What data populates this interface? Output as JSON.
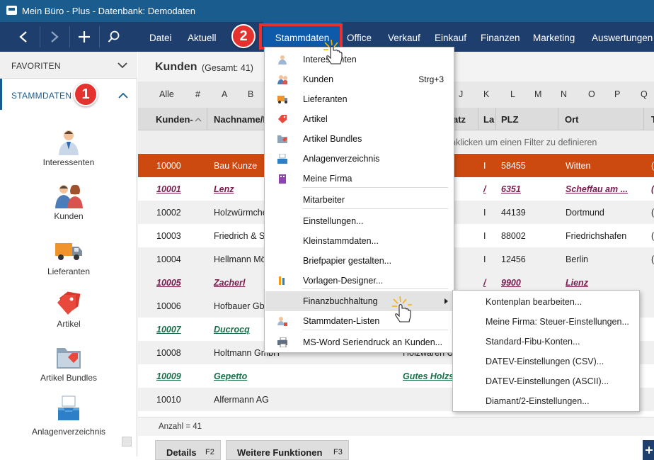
{
  "window": {
    "title": "Mein Büro - Plus - Datenbank: Demodaten"
  },
  "nav": {
    "back": "back",
    "forward": "forward",
    "add": "add",
    "search": "search"
  },
  "menu": [
    "Datei",
    "Aktuell",
    "Stammdaten",
    "Office",
    "Verkauf",
    "Einkauf",
    "Finanzen",
    "Marketing",
    "Auswertungen"
  ],
  "badges": {
    "one": "1",
    "two": "2"
  },
  "sidebar": {
    "favorites": "FAVORITEN",
    "section": "STAMMDATEN",
    "items": [
      "Interessenten",
      "Kunden",
      "Lieferanten",
      "Artikel",
      "Artikel Bundles",
      "Anlagenverzeichnis"
    ]
  },
  "list": {
    "title": "Kunden",
    "subtitle": "(Gesamt: 41)",
    "alphabet": [
      "Alle",
      "#",
      "A",
      "B",
      "J",
      "K",
      "L",
      "M",
      "N",
      "O",
      "P",
      "Q"
    ],
    "columns": [
      "Kunden-",
      "Nachname/F",
      "atz",
      "La",
      "PLZ",
      "Ort",
      "T"
    ],
    "filter_hint": "nklicken um einen Filter zu definieren",
    "rows": [
      {
        "nr": "10000",
        "name": "Bau Kunze",
        "extra": "",
        "la": "I",
        "plz": "58455",
        "ort": "Witten",
        "t": "("
      },
      {
        "nr": "10001",
        "name": "Lenz",
        "extra": "",
        "la": "/",
        "plz": "6351",
        "ort": "Scheffau am ...",
        "t": "("
      },
      {
        "nr": "10002",
        "name": "Holzwürmche",
        "extra": "",
        "la": "I",
        "plz": "44139",
        "ort": "Dortmund",
        "t": "("
      },
      {
        "nr": "10003",
        "name": "Friedrich & Sc",
        "extra": "",
        "la": "I",
        "plz": "88002",
        "ort": "Friedrichshafen",
        "t": "("
      },
      {
        "nr": "10004",
        "name": "Hellmann Mö",
        "extra": "",
        "la": "I",
        "plz": "12456",
        "ort": "Berlin",
        "t": "("
      },
      {
        "nr": "10005",
        "name": "Zacherl",
        "extra": "",
        "la": "/",
        "plz": "9900",
        "ort": "Lienz",
        "t": ""
      },
      {
        "nr": "10006",
        "name": "Hofbauer Gbr",
        "extra": "",
        "la": "",
        "plz": "",
        "ort": "",
        "t": ""
      },
      {
        "nr": "10007",
        "name": "Ducrocq",
        "extra": "",
        "la": "",
        "plz": "",
        "ort": "",
        "t": ""
      },
      {
        "nr": "10008",
        "name": "Holtmann GmbH",
        "extra": "Holzwaren U",
        "la": "",
        "plz": "",
        "ort": "",
        "t": ""
      },
      {
        "nr": "10009",
        "name": "Gepetto",
        "extra": "Gutes Holzs",
        "la": "",
        "plz": "",
        "ort": "",
        "t": ""
      },
      {
        "nr": "10010",
        "name": "Alfermann AG",
        "extra": "",
        "la": "",
        "plz": "",
        "ort": "",
        "t": ""
      }
    ],
    "count": "Anzahl = 41"
  },
  "bottom_tabs": [
    {
      "label": "Details",
      "key": "F2"
    },
    {
      "label": "Weitere Funktionen",
      "key": "F3"
    }
  ],
  "dropdown": [
    {
      "label": "Interessenten",
      "shortcut": "",
      "icon": "person-icon"
    },
    {
      "label": "Kunden",
      "shortcut": "Strg+3",
      "icon": "people-icon"
    },
    {
      "label": "Lieferanten",
      "shortcut": "",
      "icon": "truck-icon"
    },
    {
      "label": "Artikel",
      "shortcut": "",
      "icon": "tag-icon"
    },
    {
      "label": "Artikel Bundles",
      "shortcut": "",
      "icon": "folder-tag-icon"
    },
    {
      "label": "Anlagenverzeichnis",
      "shortcut": "",
      "icon": "tray-icon"
    },
    {
      "label": "Meine Firma",
      "shortcut": "",
      "icon": "building-icon"
    },
    {
      "label": "Mitarbeiter",
      "shortcut": "",
      "icon": ""
    },
    {
      "label": "Einstellungen...",
      "shortcut": "",
      "icon": ""
    },
    {
      "label": "Kleinstammdaten...",
      "shortcut": "",
      "icon": ""
    },
    {
      "label": "Briefpapier gestalten...",
      "shortcut": "",
      "icon": ""
    },
    {
      "label": "Vorlagen-Designer...",
      "shortcut": "",
      "icon": "pencils-icon"
    },
    {
      "label": "Finanzbuchhaltung",
      "shortcut": "",
      "icon": ""
    },
    {
      "label": "Stammdaten-Listen",
      "shortcut": "",
      "icon": "person-list-icon"
    },
    {
      "label": "MS-Word Seriendruck an Kunden...",
      "shortcut": "",
      "icon": "printer-icon"
    }
  ],
  "submenu": [
    "Kontenplan bearbeiten...",
    "Meine Firma: Steuer-Einstellungen...",
    "Standard-Fibu-Konten...",
    "DATEV-Einstellungen (CSV)...",
    "DATEV-Einstellungen (ASCII)...",
    "Diamant/2-Einstellungen..."
  ],
  "colors": {
    "titlebar": "#1b5c8f",
    "navbar": "#1e3f6e",
    "accent": "#0c5aa9",
    "selected_row": "#cc4a10",
    "badge": "#e5322e"
  }
}
